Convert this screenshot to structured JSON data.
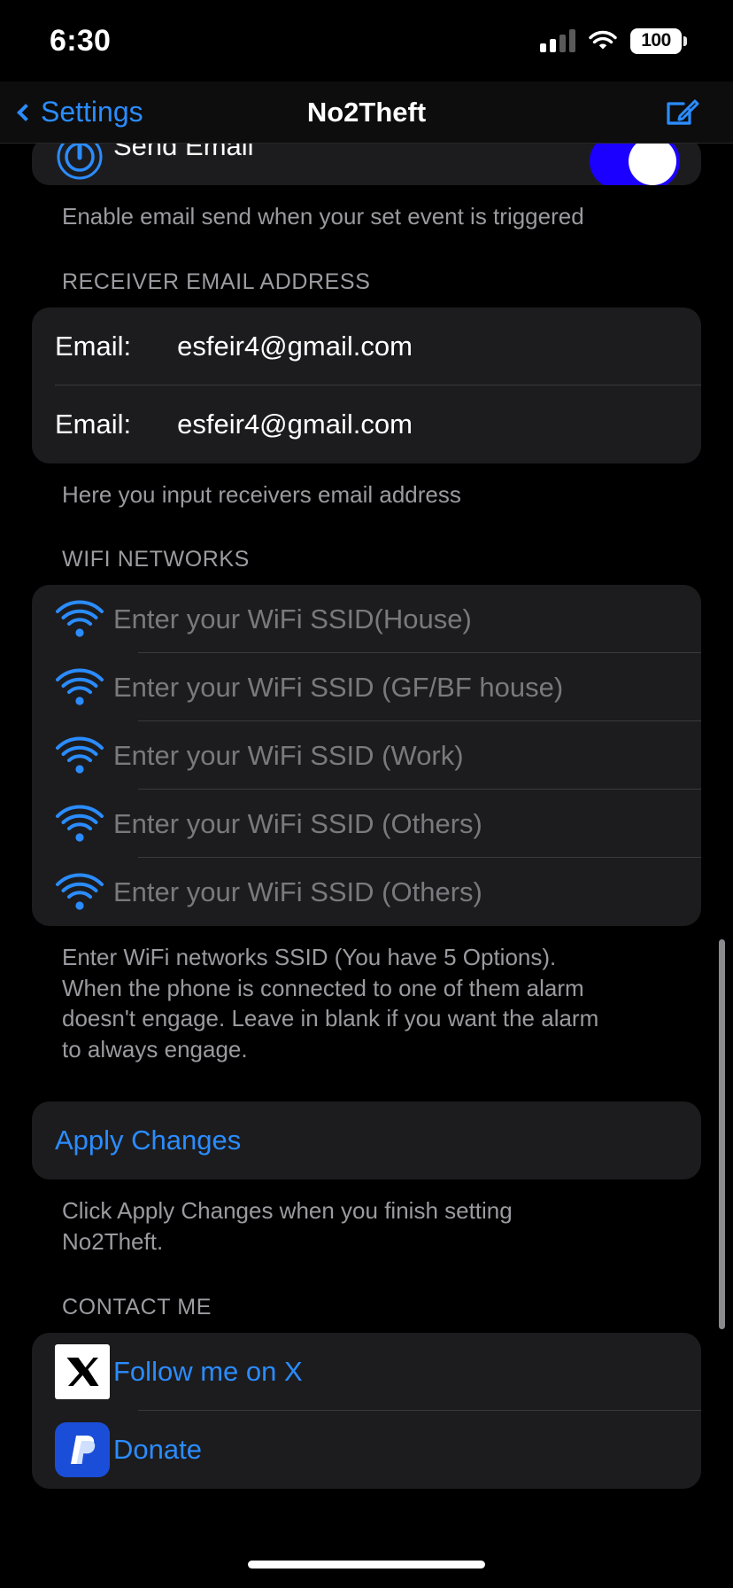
{
  "status_bar": {
    "time": "6:30",
    "battery_level": "100",
    "signal_bars_filled": 2,
    "signal_bars_total": 4,
    "wifi_icon": "wifi-icon",
    "battery_icon": "battery-icon"
  },
  "nav": {
    "back_label": "Settings",
    "title": "No2Theft",
    "compose_icon": "compose-icon",
    "back_icon": "chevron-left-icon",
    "tint_color": "#2b8cff"
  },
  "send_email": {
    "icon": "power-icon",
    "label": "Send Email",
    "toggle_on": true,
    "toggle_on_color": "#1b00ff",
    "footer": "Enable email send when your set event is triggered"
  },
  "receiver_email": {
    "header": "RECEIVER EMAIL ADDRESS",
    "rows": [
      {
        "label": "Email:",
        "value": "esfeir4@gmail.com"
      },
      {
        "label": "Email:",
        "value": "esfeir4@gmail.com"
      }
    ],
    "footer": "Here you input receivers email address"
  },
  "wifi_networks": {
    "header": "WIFI NETWORKS",
    "rows": [
      {
        "icon": "wifi-icon",
        "placeholder": "Enter your WiFi SSID(House)",
        "value": ""
      },
      {
        "icon": "wifi-icon",
        "placeholder": "Enter your WiFi SSID (GF/BF house)",
        "value": ""
      },
      {
        "icon": "wifi-icon",
        "placeholder": "Enter your WiFi SSID (Work)",
        "value": ""
      },
      {
        "icon": "wifi-icon",
        "placeholder": "Enter your WiFi SSID (Others)",
        "value": ""
      },
      {
        "icon": "wifi-icon",
        "placeholder": "Enter your WiFi SSID (Others)",
        "value": ""
      }
    ],
    "footer": "Enter WiFi networks SSID (You have 5 Options). When the phone is connected to one of them alarm doesn't engage. Leave in blank if you want the alarm to always engage."
  },
  "apply": {
    "label": "Apply Changes",
    "footer": "Click Apply Changes when you finish setting No2Theft."
  },
  "contact": {
    "header": "CONTACT ME",
    "rows": [
      {
        "icon": "x-logo-icon",
        "label": "Follow me on X"
      },
      {
        "icon": "paypal-icon",
        "label": "Donate"
      }
    ]
  }
}
